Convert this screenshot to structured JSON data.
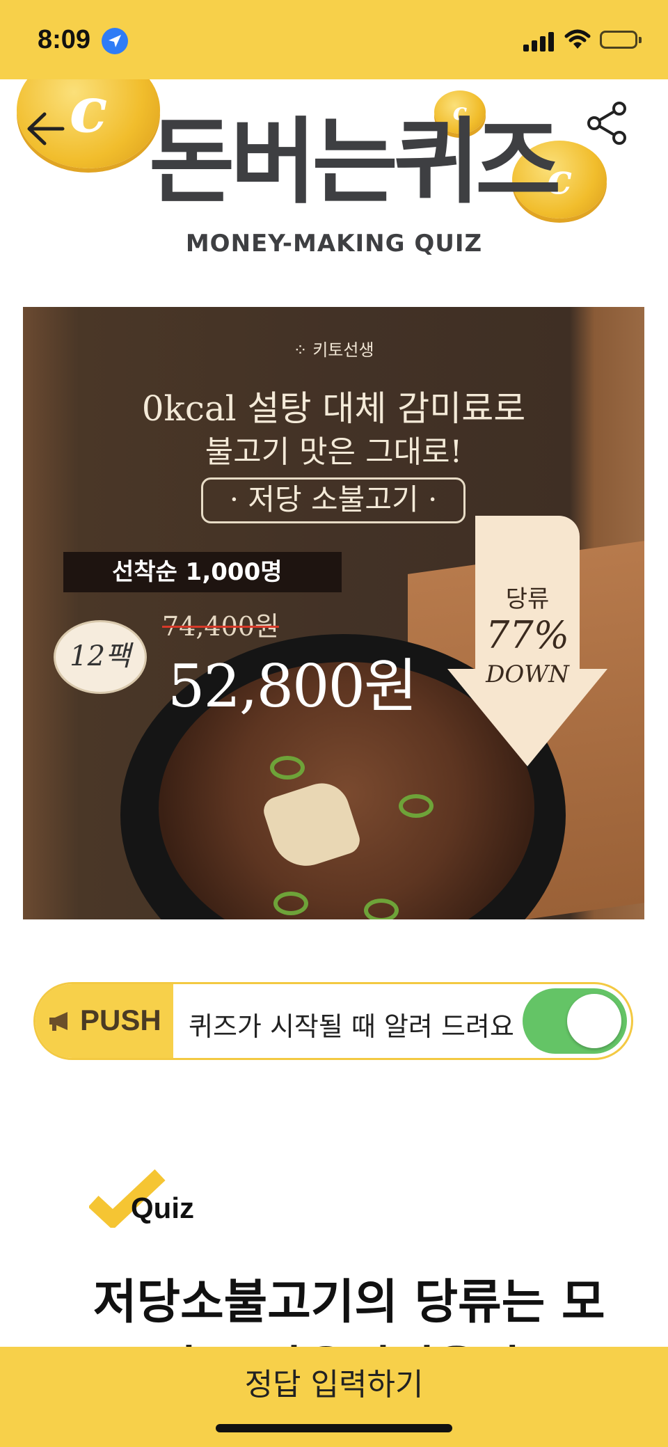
{
  "status_bar": {
    "time": "8:09"
  },
  "header": {
    "title": "돈버는퀴즈",
    "subtitle": "MONEY-MAKING QUIZ",
    "coin_letter": "c",
    "back_icon": "arrow-left-icon",
    "share_icon": "share-icon"
  },
  "banner": {
    "brand": "⁘ 키토선생",
    "headline": "0kcal 설탕 대체 감미료로",
    "headline2": "불고기 맛은 그대로!",
    "product": "· 저당 소불고기 ·",
    "ribbon": "선착순 1,000명",
    "pack": "12팩",
    "price_old": "74,400원",
    "price_new": "52,800원",
    "arrow_line1": "당류",
    "arrow_line2": "77%",
    "arrow_line3": "DOWN"
  },
  "push": {
    "tag": "PUSH",
    "text": "퀴즈가 시작될 때 알려 드려요",
    "enabled": true,
    "colors": {
      "tag_bg": "#f7d04a",
      "toggle_on": "#64c466"
    }
  },
  "quiz": {
    "label": "Quiz",
    "question": "저당소불고기의 당류는 모두 몇% 다운되었을까요?"
  },
  "bottom": {
    "submit_label": "정답 입력하기"
  },
  "colors": {
    "accent": "#f7d04a",
    "title": "#3e3f42"
  }
}
